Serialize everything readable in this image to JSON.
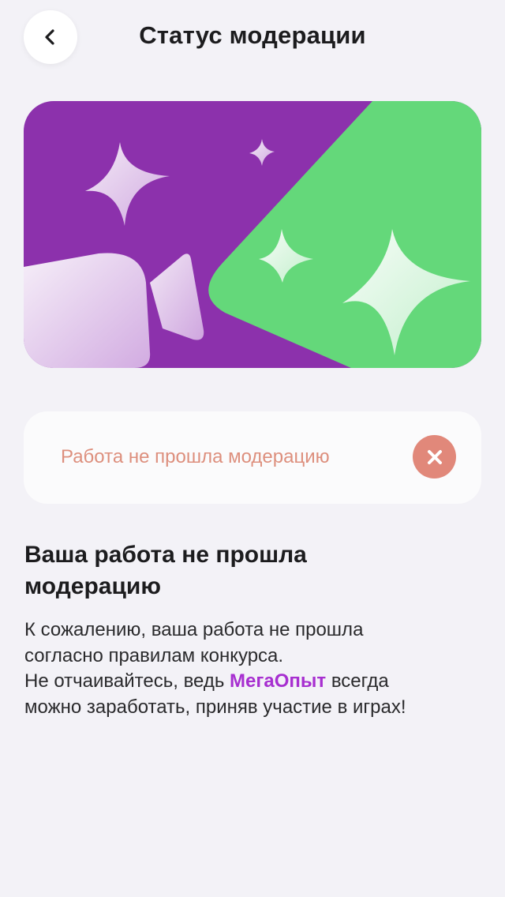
{
  "header": {
    "title": "Статус модерации",
    "back_icon": "chevron-left-icon"
  },
  "banner": {
    "left_color": "#8c31ac",
    "right_color": "#64d87a",
    "icon": "sparkles-icon"
  },
  "status": {
    "text": "Работа не прошла модерацию",
    "text_color": "#dd8f7d",
    "icon": "close-circle-icon",
    "icon_color": "#e1887a"
  },
  "content": {
    "heading": "Ваша работа не прошла модерацию",
    "line1": "К сожалению, ваша работа не прошла",
    "line2": "согласно правилам конкурса.",
    "line3_prefix": "Не отчаивайтесь, ведь ",
    "brand": "МегаОпыт",
    "line3_suffix": " всегда",
    "line4": "можно заработать, приняв участие в играх!",
    "brand_color": "#a72fd0"
  }
}
